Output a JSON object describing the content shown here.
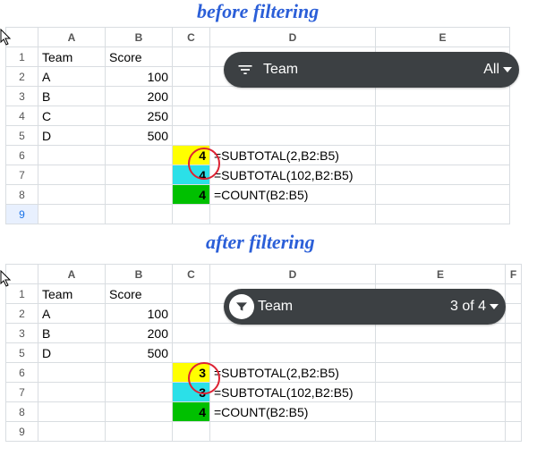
{
  "captions": {
    "before": "before filtering",
    "after": "after filtering"
  },
  "columns": [
    "A",
    "B",
    "C",
    "D",
    "E"
  ],
  "headers": {
    "team": "Team",
    "score": "Score"
  },
  "before": {
    "rows": [
      "1",
      "2",
      "3",
      "4",
      "5",
      "6",
      "7",
      "8",
      "9"
    ],
    "data": [
      {
        "team": "A",
        "score": "100"
      },
      {
        "team": "B",
        "score": "200"
      },
      {
        "team": "C",
        "score": "250"
      },
      {
        "team": "D",
        "score": "500"
      }
    ],
    "results": [
      {
        "value": "4",
        "formula": "=SUBTOTAL(2,B2:B5)",
        "bg": "yellow"
      },
      {
        "value": "4",
        "formula": "=SUBTOTAL(102,B2:B5)",
        "bg": "cyan"
      },
      {
        "value": "4",
        "formula": "=COUNT(B2:B5)",
        "bg": "green"
      }
    ],
    "chip": {
      "label": "Team",
      "value": "All"
    }
  },
  "after": {
    "rows": [
      "1",
      "2",
      "3",
      "5",
      "6",
      "7",
      "8",
      "9"
    ],
    "data": [
      {
        "team": "A",
        "score": "100"
      },
      {
        "team": "B",
        "score": "200"
      },
      {
        "team": "D",
        "score": "500"
      }
    ],
    "results": [
      {
        "value": "3",
        "formula": "=SUBTOTAL(2,B2:B5)",
        "bg": "yellow"
      },
      {
        "value": "3",
        "formula": "=SUBTOTAL(102,B2:B5)",
        "bg": "cyan"
      },
      {
        "value": "4",
        "formula": "=COUNT(B2:B5)",
        "bg": "green"
      }
    ],
    "chip": {
      "label": "Team",
      "value": "3 of 4"
    }
  },
  "chart_data": {
    "type": "table",
    "title": "SUBTOTAL vs COUNT before and after filtering",
    "series": [
      {
        "name": "before filtering",
        "categories": [
          "SUBTOTAL(2,B2:B5)",
          "SUBTOTAL(102,B2:B5)",
          "COUNT(B2:B5)"
        ],
        "values": [
          4,
          4,
          4
        ]
      },
      {
        "name": "after filtering",
        "categories": [
          "SUBTOTAL(2,B2:B5)",
          "SUBTOTAL(102,B2:B5)",
          "COUNT(B2:B5)"
        ],
        "values": [
          3,
          3,
          4
        ]
      }
    ]
  }
}
